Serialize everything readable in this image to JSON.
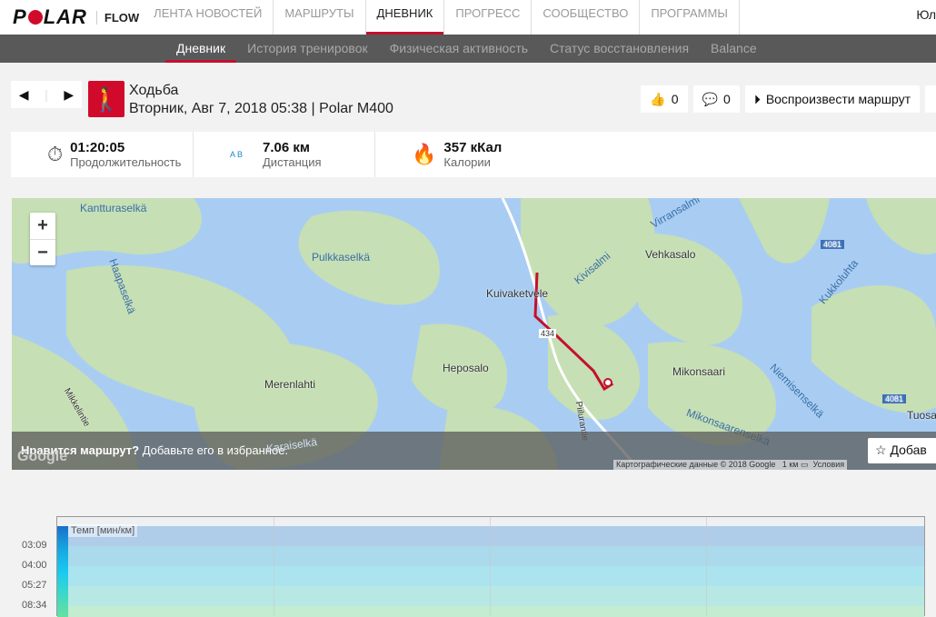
{
  "header": {
    "logo": "POLAR",
    "app": "FLOW",
    "nav": [
      "ЛЕНТА НОВОСТЕЙ",
      "МАРШРУТЫ",
      "ДНЕВНИК",
      "ПРОГРЕСС",
      "СООБЩЕСТВО",
      "ПРОГРАММЫ"
    ],
    "active_nav": "ДНЕВНИК",
    "user": "Юл"
  },
  "subnav": [
    "Дневник",
    "История тренировок",
    "Физическая активность",
    "Статус восстановления",
    "Balance"
  ],
  "session": {
    "sport": "Ходьба",
    "details": "Вторник, Авг 7, 2018 05:38 | Polar M400"
  },
  "actions": {
    "likes": "0",
    "comments": "0",
    "replay": "Воспроизвести маршрут"
  },
  "stats": [
    {
      "icon": "stopwatch-icon",
      "value": "01:20:05",
      "label": "Продолжительность"
    },
    {
      "icon": "distance-icon",
      "value": "7.06 км",
      "label": "Дистанция",
      "prefix": "A B"
    },
    {
      "icon": "flame-icon",
      "value": "357 кКал",
      "label": "Калории"
    }
  ],
  "map": {
    "labels": [
      "Kantturaselkä",
      "Pulkkaselkä",
      "Haapaselkä",
      "Kuivaketvele",
      "Kivisalmi",
      "Virransalmi",
      "Vehkasalo",
      "Kukkoluhta",
      "Heposalo",
      "Merenlahti",
      "Mikonsaari",
      "Niemisenselkä",
      "Mikonsaarenselkä",
      "Tuosa",
      "Karaiselkä",
      "Piilurantie",
      "Mikkelintie",
      "4081",
      "4081",
      "434"
    ],
    "prompt_q": "Нравится маршрут?",
    "prompt_text": "Добавьте его в избранное.",
    "add": "Добав",
    "attribution": "Картографические данные © 2018 Google",
    "scale": "1 км",
    "terms": "Условия",
    "google": "Google"
  },
  "chart": {
    "label": "Темп [мин/км]",
    "yticks": [
      "03:09",
      "04:00",
      "05:27",
      "08:34"
    ]
  }
}
